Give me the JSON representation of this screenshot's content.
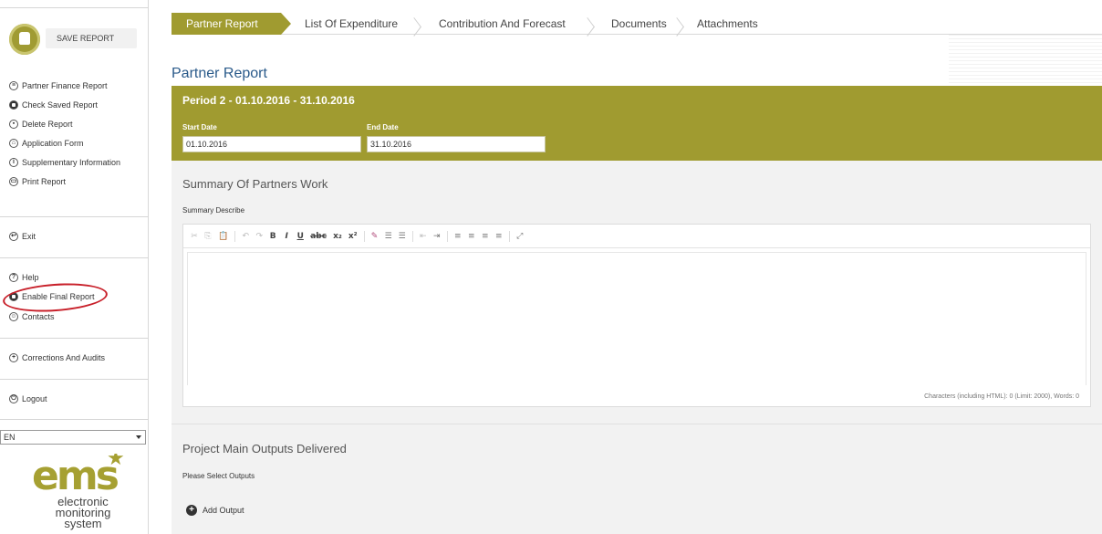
{
  "sidebar": {
    "save_label": "SAVE REPORT",
    "items_top": [
      {
        "label": "Partner Finance Report",
        "icon": "list-icon"
      },
      {
        "label": "Check Saved Report",
        "icon": "check-icon"
      },
      {
        "label": "Delete Report",
        "icon": "trash-icon"
      },
      {
        "label": "Application Form",
        "icon": "building-icon"
      },
      {
        "label": "Supplementary Information",
        "icon": "info-icon"
      },
      {
        "label": "Print Report",
        "icon": "print-icon"
      }
    ],
    "exit_label": "Exit",
    "help_label": "Help",
    "enable_final_label": "Enable Final Report",
    "contacts_label": "Contacts",
    "corrections_label": "Corrections And Audits",
    "logout_label": "Logout",
    "language": "EN",
    "logo_mark": "ems",
    "logo_text_1": "electronic",
    "logo_text_2": "monitoring",
    "logo_text_3": "system"
  },
  "tabs": [
    {
      "label": "Partner Report",
      "active": true
    },
    {
      "label": "List Of Expenditure",
      "active": false
    },
    {
      "label": "Contribution And Forecast",
      "active": false
    },
    {
      "label": "Documents",
      "active": false
    },
    {
      "label": "Attachments",
      "active": false
    }
  ],
  "main": {
    "page_title": "Partner Report",
    "period_title": "Period 2 - 01.10.2016 - 31.10.2016",
    "start_date_label": "Start Date",
    "start_date_value": "01.10.2016",
    "end_date_label": "End Date",
    "end_date_value": "31.10.2016",
    "summary_title": "Summary Of Partners Work",
    "summary_label": "Summary Describe",
    "char_count": "Characters (including HTML): 0 (Limit: 2000), Words: 0",
    "outputs_title": "Project Main Outputs Delivered",
    "outputs_label": "Please Select Outputs",
    "add_output_label": "Add Output"
  },
  "colors": {
    "accent": "#a09b30",
    "title_blue": "#2a5a8a",
    "highlight_red": "#c8202a"
  }
}
